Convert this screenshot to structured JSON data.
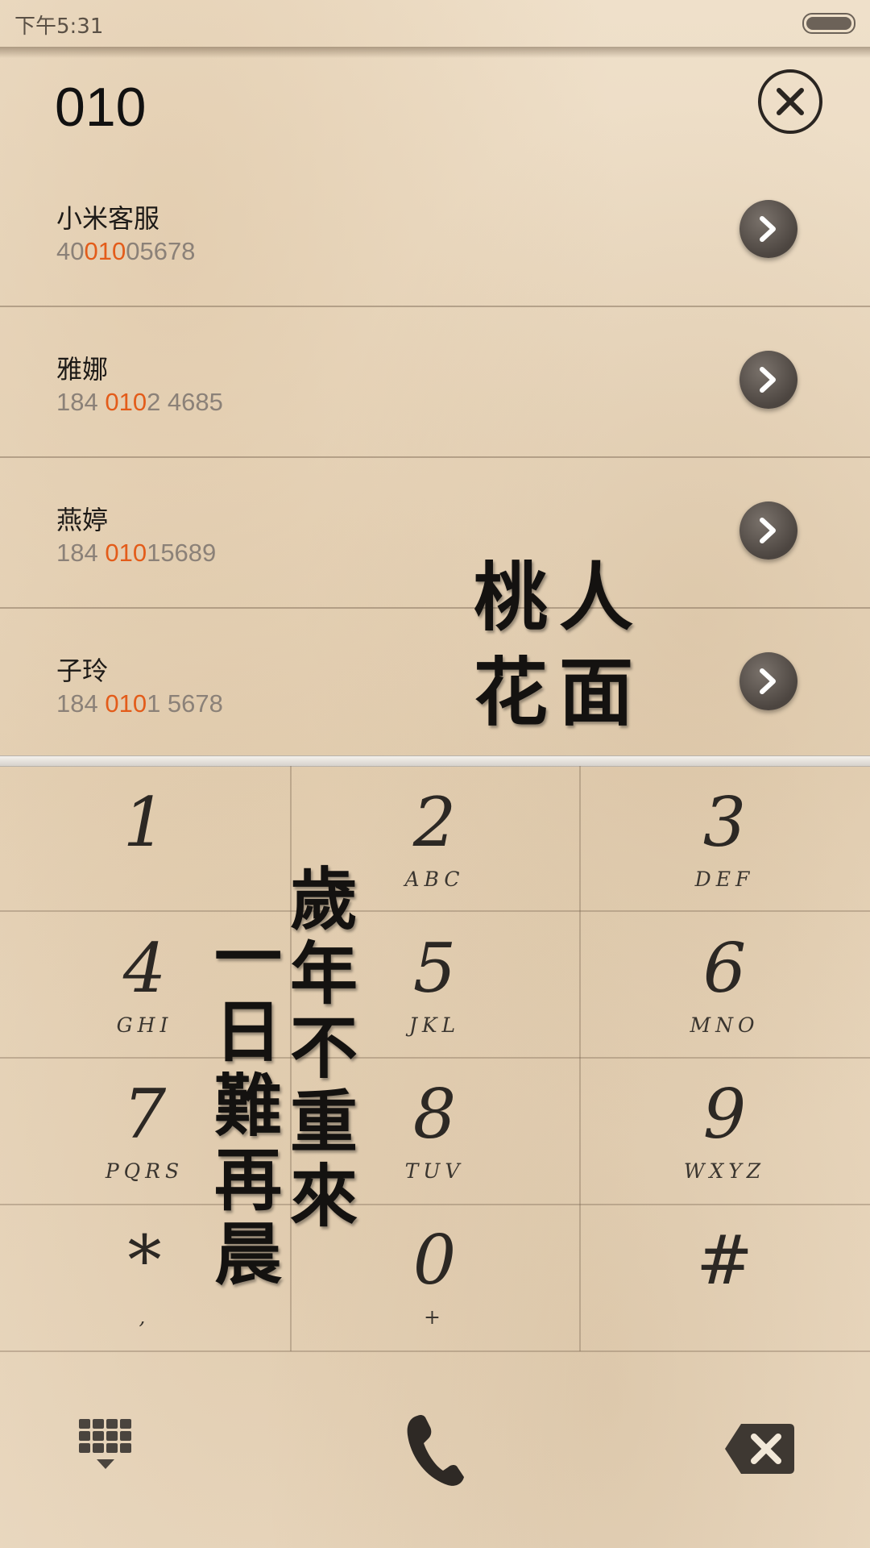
{
  "status_bar": {
    "time": "下午5:31"
  },
  "dialer": {
    "input": "010"
  },
  "results": [
    {
      "name": "小米客服",
      "num_pre": "40",
      "num_hl": "010",
      "num_post": "05678"
    },
    {
      "name": "雅娜",
      "num_pre": "184 ",
      "num_hl": "010",
      "num_post": "2 4685"
    },
    {
      "name": "燕婷",
      "num_pre": "184 ",
      "num_hl": "010",
      "num_post": "15689"
    },
    {
      "name": "子玲",
      "num_pre": "184 ",
      "num_hl": "010",
      "num_post": "1 5678"
    }
  ],
  "keypad": [
    {
      "digit": "1",
      "letters": ""
    },
    {
      "digit": "2",
      "letters": "ABC"
    },
    {
      "digit": "3",
      "letters": "DEF"
    },
    {
      "digit": "4",
      "letters": "GHI"
    },
    {
      "digit": "5",
      "letters": "JKL"
    },
    {
      "digit": "6",
      "letters": "MNO"
    },
    {
      "digit": "7",
      "letters": "PQRS"
    },
    {
      "digit": "8",
      "letters": "TUV"
    },
    {
      "digit": "9",
      "letters": "WXYZ"
    },
    {
      "digit": "*",
      "letters": ","
    },
    {
      "digit": "0",
      "letters": "+"
    },
    {
      "digit": "#",
      "letters": ""
    }
  ],
  "decor": {
    "poem_a_line1": "桃人",
    "poem_a_line2": "花面",
    "poem_b_col1": "一日難再晨",
    "poem_b_col2": "歲年不重來"
  },
  "icons": {
    "clear": "close-circle-icon",
    "detail": "chevron-right-icon",
    "keypad_toggle": "keypad-grid-icon",
    "call": "phone-icon",
    "backspace": "backspace-icon"
  },
  "colors": {
    "highlight": "#e35c1a",
    "ink": "#2c2824"
  }
}
